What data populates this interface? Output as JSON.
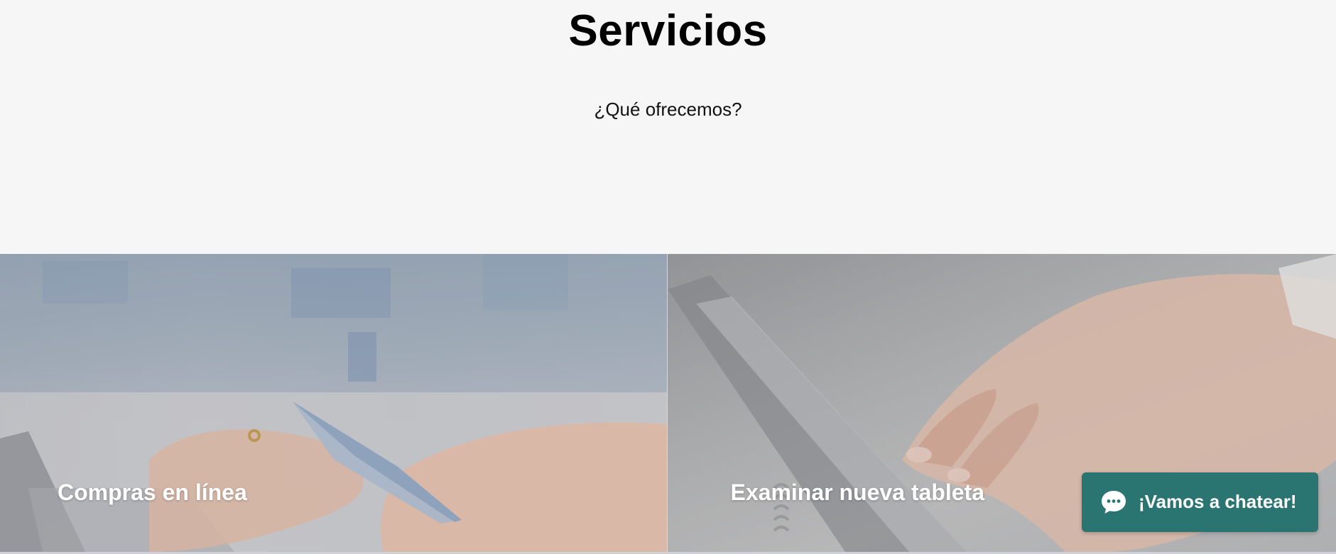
{
  "header": {
    "title": "Servicios",
    "subtitle": "¿Qué ofrecemos?"
  },
  "services": [
    {
      "label": "Compras en línea",
      "image": "hands-credit-card-laptop"
    },
    {
      "label": "Examinar nueva tableta",
      "image": "hand-tapping-tablet"
    }
  ],
  "chat": {
    "label": "¡Vamos a chatear!",
    "icon": "chat-bubble-icon",
    "color": "#2a7472"
  },
  "colors": {
    "background": "#f6f6f6",
    "title": "#000000",
    "card_text": "#ffffff"
  }
}
